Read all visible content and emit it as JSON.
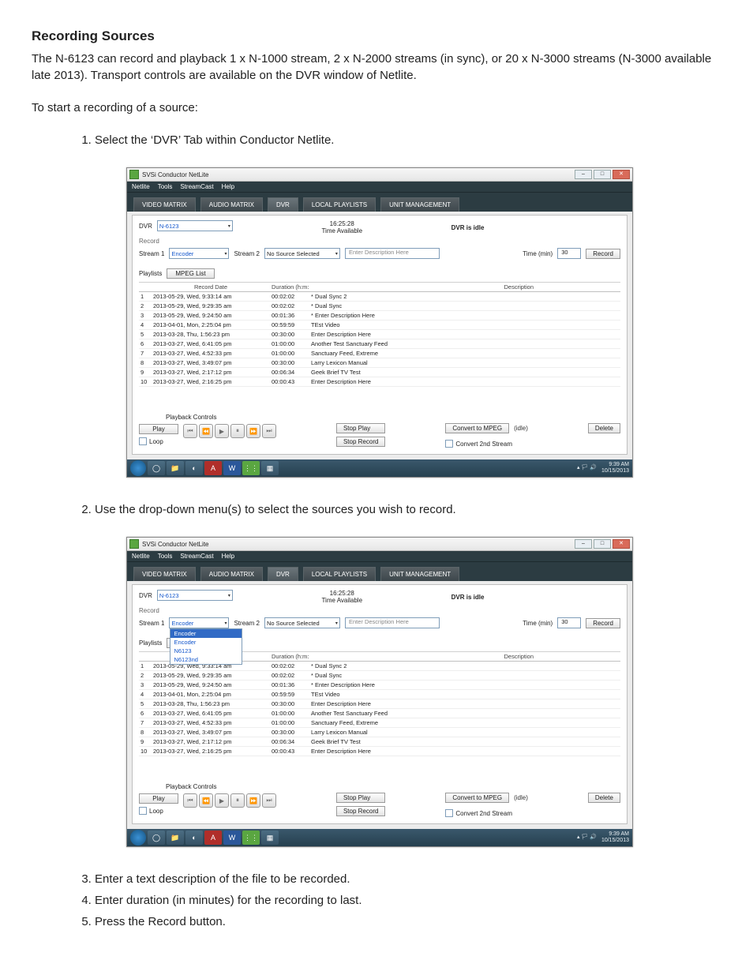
{
  "heading": "Recording Sources",
  "intro": "The N-6123 can record and playback  1 x N-1000 stream, 2 x N-2000 streams (in sync), or 20 x N-3000 streams (N-3000 available late 2013). Transport controls are available on the DVR window of Netlite.",
  "lead": "To start a recording of a source:",
  "steps_a": [
    "Select the ‘DVR’ Tab within Conductor Netlite."
  ],
  "steps_b": [
    "Use the drop-down menu(s) to select the sources you wish to record."
  ],
  "steps_c": [
    "Enter a text description of the file to be recorded.",
    "Enter duration (in minutes) for the recording to last.",
    "Press the Record button."
  ],
  "app": {
    "title": "SVSi Conductor NetLite",
    "menu": [
      "Netlite",
      "Tools",
      "StreamCast",
      "Help"
    ],
    "tabs": [
      "VIDEO MATRIX",
      "AUDIO MATRIX",
      "DVR",
      "LOCAL PLAYLISTS",
      "UNIT MANAGEMENT"
    ],
    "active_tab": 2,
    "dvr_label": "DVR",
    "dvr_select": "N-6123",
    "time_value": "16:25:28",
    "time_avail": "Time Available",
    "dvr_status": "DVR is idle",
    "record_lbl": "Record",
    "stream1_lbl": "Stream 1",
    "stream1_val": "Encoder",
    "stream2_lbl": "Stream 2",
    "stream2_val": "No Source Selected",
    "desc_placeholder": "Enter Description Here",
    "time_min_lbl": "Time (min)",
    "time_min_val": "30",
    "record_btn": "Record",
    "playlists_lbl": "Playlists",
    "mpeg_btn": "MPEG List",
    "cols": {
      "idx": "",
      "date": "Record Date",
      "dur": "Duration (h:m:s)",
      "desc": "Description"
    },
    "rows": [
      {
        "i": "1",
        "d": "2013-05-29, Wed, 9:33:14 am",
        "t": "00:02:02",
        "s": "* Dual Sync 2"
      },
      {
        "i": "2",
        "d": "2013-05-29, Wed, 9:29:35 am",
        "t": "00:02:02",
        "s": "* Dual Sync"
      },
      {
        "i": "3",
        "d": "2013-05-29, Wed, 9:24:50 am",
        "t": "00:01:36",
        "s": "* Enter Description Here"
      },
      {
        "i": "4",
        "d": "2013-04-01, Mon, 2:25:04 pm",
        "t": "00:59:59",
        "s": "TEst Video"
      },
      {
        "i": "5",
        "d": "2013-03-28, Thu, 1:56:23 pm",
        "t": "00:30:00",
        "s": "Enter Description Here"
      },
      {
        "i": "6",
        "d": "2013-03-27, Wed, 6:41:05 pm",
        "t": "01:00:00",
        "s": "Another Test Sanctuary Feed"
      },
      {
        "i": "7",
        "d": "2013-03-27, Wed, 4:52:33 pm",
        "t": "01:00:00",
        "s": "Sanctuary Feed, Extreme"
      },
      {
        "i": "8",
        "d": "2013-03-27, Wed, 3:49:07 pm",
        "t": "00:30:00",
        "s": "Larry Lexicon Manual"
      },
      {
        "i": "9",
        "d": "2013-03-27, Wed, 2:17:12 pm",
        "t": "00:06:34",
        "s": "Geek Brief TV Test"
      },
      {
        "i": "10",
        "d": "2013-03-27, Wed, 2:16:25 pm",
        "t": "00:00:43",
        "s": "Enter Description Here"
      }
    ],
    "pb_label": "Playback Controls",
    "play_btn": "Play",
    "loop_lbl": "Loop",
    "stop_play": "Stop Play",
    "stop_rec": "Stop Record",
    "convert_btn": "Convert to MPEG",
    "convert_idle": "(idle)",
    "convert2_lbl": "Convert 2nd Stream",
    "delete_btn": "Delete",
    "dd_options": [
      "Encoder",
      "Encoder",
      "N6123",
      "N6123nd"
    ],
    "tray_time": "9:39 AM",
    "tray_date": "10/15/2013"
  }
}
